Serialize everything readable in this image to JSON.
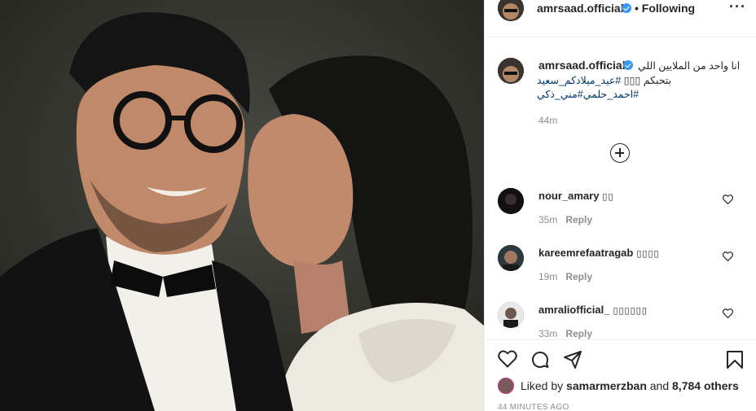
{
  "post": {
    "author": "amrsaad.official",
    "follow_status": "• Following",
    "more_icon": "more-options-icon"
  },
  "caption": {
    "author": "amrsaad.official",
    "line1": "انا واحد من الملايين اللي",
    "line2_text": "بتحبكم ▯▯▯ ",
    "line2_hashtag": "#عيد_ميلادكم_سعيد",
    "line3_hashtag": "#احمد_حلمي#مني_ذكي",
    "time": "44m"
  },
  "comments": [
    {
      "user": "nour_amary",
      "text": "▯▯",
      "time": "35m",
      "reply": "Reply"
    },
    {
      "user": "kareemrefaatragab",
      "text": "▯▯▯▯",
      "time": "19m",
      "reply": "Reply"
    },
    {
      "user": "amraliofficial_",
      "text": "▯▯▯▯▯▯",
      "time": "33m",
      "reply": "Reply"
    }
  ],
  "likes": {
    "prefix": "Liked by ",
    "user": "samarmerzban",
    "middle": " and ",
    "others": "8,784 others"
  },
  "timestamp": "44 MINUTES AGO",
  "colors": {
    "verified": "#3897f0",
    "hashtag": "#00376b",
    "muted": "#8e8e8e",
    "text": "#262626"
  }
}
